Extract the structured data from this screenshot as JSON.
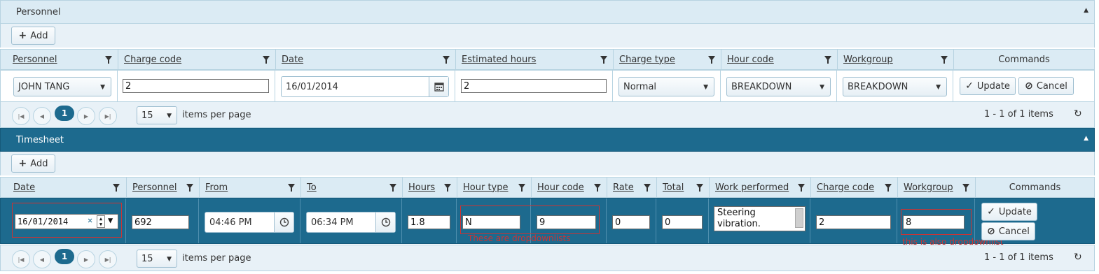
{
  "personnel_panel": {
    "title": "Personnel",
    "add_label": "Add",
    "columns": [
      "Personnel",
      "Charge code",
      "Date",
      "Estimated hours",
      "Charge type",
      "Hour code",
      "Workgroup",
      "Commands"
    ],
    "row": {
      "personnel": "JOHN TANG",
      "charge_code": "2",
      "date": "16/01/2014",
      "estimated_hours": "2",
      "charge_type": "Normal",
      "hour_code": "BREAKDOWN",
      "workgroup": "BREAKDOWN"
    },
    "update_label": "Update",
    "cancel_label": "Cancel",
    "pager": {
      "page": "1",
      "page_size": "15",
      "items_per_page_label": "items per page",
      "summary": "1 - 1 of 1 items"
    }
  },
  "timesheet_panel": {
    "title": "Timesheet",
    "add_label": "Add",
    "columns": [
      "Date",
      "Personnel",
      "From",
      "To",
      "Hours",
      "Hour type",
      "Hour code",
      "Rate",
      "Total",
      "Work performed",
      "Charge code",
      "Workgroup",
      "Commands"
    ],
    "row": {
      "date": "16/01/2014",
      "personnel": "692",
      "from": "04:46 PM",
      "to": "06:34 PM",
      "hours": "1.8",
      "hour_type": "N",
      "hour_code": "9",
      "rate": "0",
      "total": "0",
      "work_performed": "Steering vibration.",
      "charge_code": "2",
      "workgroup": "8"
    },
    "update_label": "Update",
    "cancel_label": "Cancel",
    "annotation_dropdowns": "These are dropdownlists",
    "annotation_workgroup": "this is also dropdownlist",
    "pager": {
      "page": "1",
      "page_size": "15",
      "items_per_page_label": "items per page",
      "summary": "1 - 1 of 1 items"
    }
  },
  "colors": {
    "header_light": "#dbebf4",
    "header_dark": "#1d6a8e",
    "border": "#b7d3e1",
    "annotation": "#cc3333"
  },
  "icons": [
    "plus-icon",
    "filter-icon",
    "calendar-icon",
    "clock-icon",
    "check-icon",
    "cancel-icon",
    "first-page-icon",
    "prev-page-icon",
    "next-page-icon",
    "last-page-icon",
    "refresh-icon",
    "collapse-icon",
    "clear-icon",
    "spinner-icon"
  ]
}
